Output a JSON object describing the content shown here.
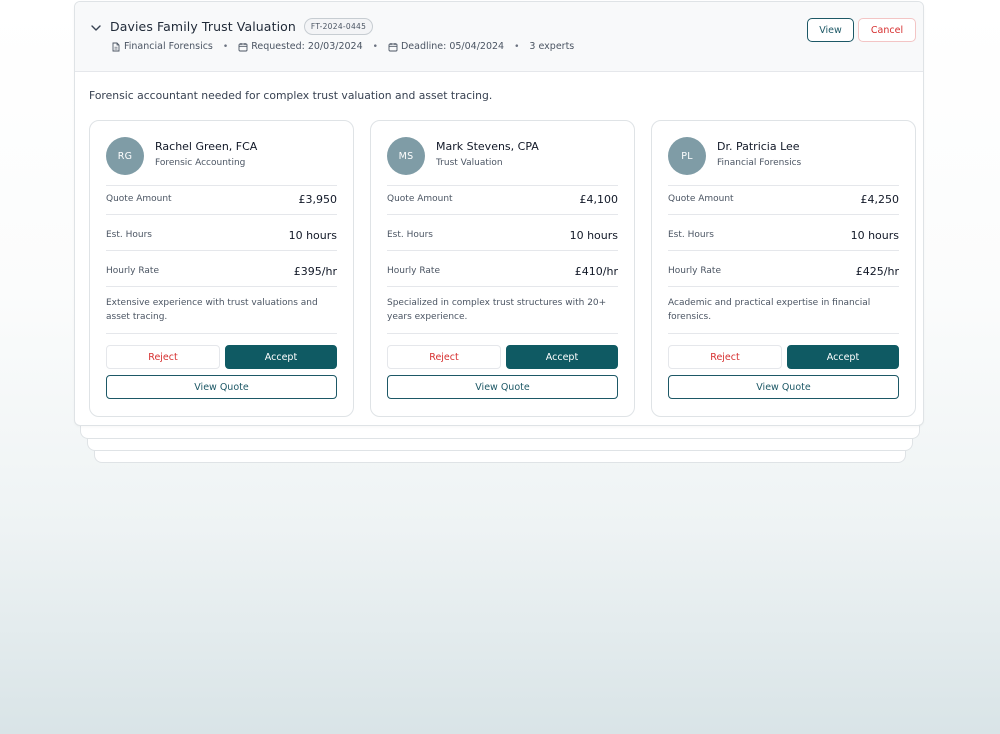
{
  "request": {
    "title": "Davies Family Trust Valuation",
    "ref": "FT-2024-0445",
    "category": "Financial Forensics",
    "requested": "Requested: 20/03/2024",
    "deadline": "Deadline: 05/04/2024",
    "experts": "3 experts",
    "view_label": "View",
    "cancel_label": "Cancel",
    "description": "Forensic accountant needed for complex trust valuation and asset tracing.",
    "icons": {
      "collapse": "chevron-down-icon",
      "category": "document-icon",
      "date": "calendar-icon"
    }
  },
  "labels": {
    "quote_amount": "Quote Amount",
    "est_hours": "Est. Hours",
    "hourly_rate": "Hourly Rate",
    "reject": "Reject",
    "accept": "Accept",
    "view_quote": "View Quote"
  },
  "colors": {
    "primary": "#0f5a63",
    "outline": "#1d5866",
    "danger": "#d62f2f",
    "avatar": "#7f9ca6"
  },
  "quotes": [
    {
      "initials": "RG",
      "name": "Rachel Green, FCA",
      "specialty": "Forensic Accounting",
      "amount": "£3,950",
      "hours": "10 hours",
      "rate": "£395/hr",
      "note": "Extensive experience with trust valuations and asset tracing."
    },
    {
      "initials": "MS",
      "name": "Mark Stevens, CPA",
      "specialty": "Trust Valuation",
      "amount": "£4,100",
      "hours": "10 hours",
      "rate": "£410/hr",
      "note": "Specialized in complex trust structures with 20+ years experience."
    },
    {
      "initials": "PL",
      "name": "Dr. Patricia Lee",
      "specialty": "Financial Forensics",
      "amount": "£4,250",
      "hours": "10 hours",
      "rate": "£425/hr",
      "note": "Academic and practical expertise in financial forensics."
    }
  ]
}
